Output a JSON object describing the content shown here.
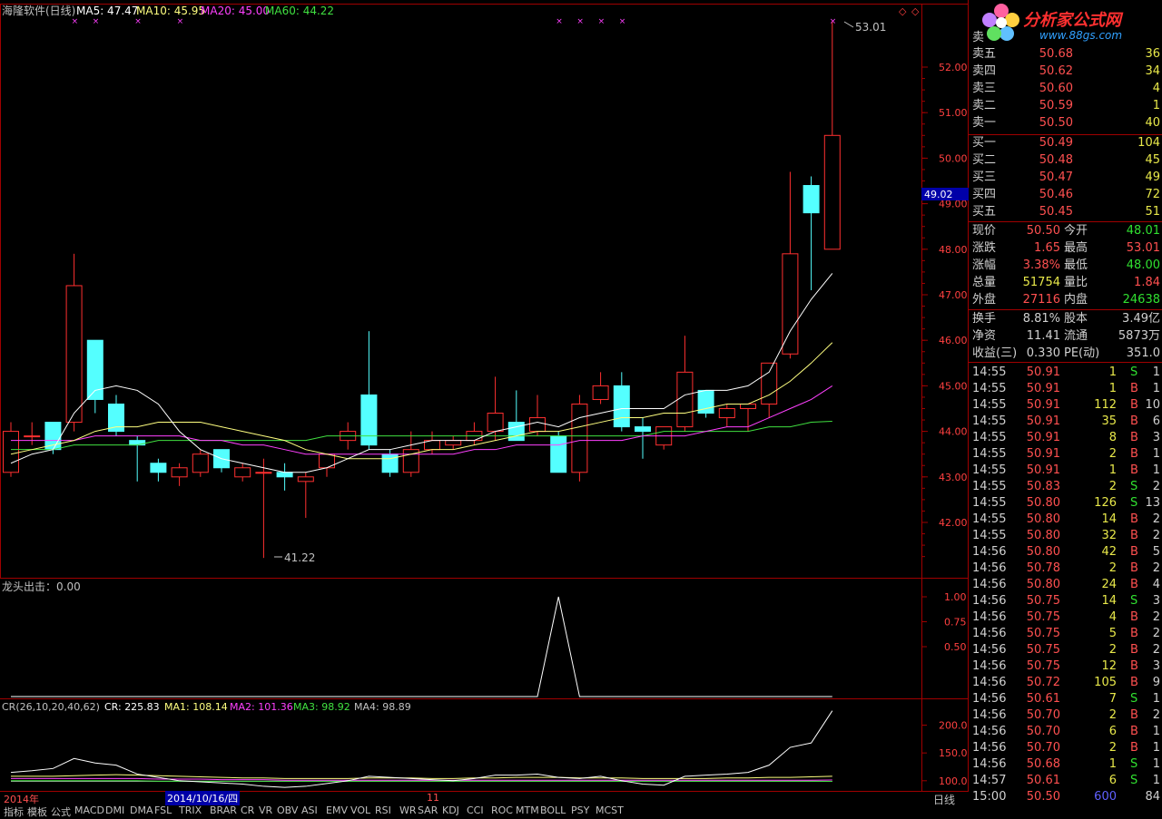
{
  "chart_header": {
    "title": "海隆软件(日线)",
    "ma5": "MA5: 47.47",
    "ma10": "MA10: 45.95",
    "ma20": "MA20: 45.00",
    "ma60": "MA60: 44.22"
  },
  "price_axis": [
    "52.00",
    "51.00",
    "50.00",
    "49.00",
    "48.00",
    "47.00",
    "46.00",
    "45.00",
    "44.00",
    "43.00",
    "42.00"
  ],
  "current_price_tag": "49.02",
  "high_label": "53.01",
  "low_label": "41.22",
  "indicator1": {
    "title": "龙头出击：0.00",
    "axis": [
      "1.00",
      "0.75",
      "0.50"
    ]
  },
  "indicator2": {
    "title": "CR(26,10,20,40,62)",
    "cr": "CR: 225.83",
    "ma1": "MA1: 108.14",
    "ma2": "MA2: 101.36",
    "ma3": "MA3: 98.92",
    "ma4": "MA4: 98.89",
    "axis": [
      "200.0",
      "150.0",
      "100.0"
    ]
  },
  "bottom": {
    "year_label": "2014年",
    "date_cursor": "2014/10/16/四",
    "month_label": "11",
    "period": "日线",
    "tabs": [
      "指标",
      "模板",
      "公式",
      "MACD",
      "DMI",
      "DMA",
      "FSL",
      "TRIX",
      "BRAR",
      "CR",
      "VR",
      "OBV",
      "ASI",
      "EMV",
      "VOL",
      "RSI",
      "WR",
      "SAR",
      "KDJ",
      "CCI",
      "ROC",
      "MTM",
      "BOLL",
      "PSY",
      "MCST"
    ]
  },
  "order_book": {
    "sell_header": "卖",
    "sells": [
      {
        "label": "卖五",
        "price": "50.68",
        "vol": "36"
      },
      {
        "label": "卖四",
        "price": "50.62",
        "vol": "34"
      },
      {
        "label": "卖三",
        "price": "50.60",
        "vol": "4"
      },
      {
        "label": "卖二",
        "price": "50.59",
        "vol": "1"
      },
      {
        "label": "卖一",
        "price": "50.50",
        "vol": "40"
      }
    ],
    "buys": [
      {
        "label": "买一",
        "price": "50.49",
        "vol": "104"
      },
      {
        "label": "买二",
        "price": "50.48",
        "vol": "45"
      },
      {
        "label": "买三",
        "price": "50.47",
        "vol": "49"
      },
      {
        "label": "买四",
        "price": "50.46",
        "vol": "72"
      },
      {
        "label": "买五",
        "price": "50.45",
        "vol": "51"
      }
    ]
  },
  "quote": [
    {
      "l1": "现价",
      "v1": "50.50",
      "l2": "今开",
      "v2": "48.01",
      "c1": "red",
      "c2": "green"
    },
    {
      "l1": "涨跌",
      "v1": "1.65",
      "l2": "最高",
      "v2": "53.01",
      "c1": "red",
      "c2": "red"
    },
    {
      "l1": "涨幅",
      "v1": "3.38%",
      "l2": "最低",
      "v2": "48.00",
      "c1": "red",
      "c2": "green"
    },
    {
      "l1": "总量",
      "v1": "51754",
      "l2": "量比",
      "v2": "1.84",
      "c1": "yellow",
      "c2": "red"
    },
    {
      "l1": "外盘",
      "v1": "27116",
      "l2": "内盘",
      "v2": "24638",
      "c1": "red",
      "c2": "green"
    }
  ],
  "fundamentals": [
    {
      "l1": "换手",
      "v1": "8.81%",
      "l2": "股本",
      "v2": "3.49亿"
    },
    {
      "l1": "净资",
      "v1": "11.41",
      "l2": "流通",
      "v2": "5873万"
    },
    {
      "l1": "收益(三)",
      "v1": "0.330",
      "l2": "PE(动)",
      "v2": "351.0"
    }
  ],
  "ticks": [
    {
      "t": "14:55",
      "p": "50.91",
      "v": "1",
      "s": "S",
      "n": "1"
    },
    {
      "t": "14:55",
      "p": "50.91",
      "v": "1",
      "s": "B",
      "n": "1"
    },
    {
      "t": "14:55",
      "p": "50.91",
      "v": "112",
      "s": "B",
      "n": "10"
    },
    {
      "t": "14:55",
      "p": "50.91",
      "v": "35",
      "s": "B",
      "n": "6"
    },
    {
      "t": "14:55",
      "p": "50.91",
      "v": "8",
      "s": "B",
      "n": "3"
    },
    {
      "t": "14:55",
      "p": "50.91",
      "v": "2",
      "s": "B",
      "n": "1"
    },
    {
      "t": "14:55",
      "p": "50.91",
      "v": "1",
      "s": "B",
      "n": "1"
    },
    {
      "t": "14:55",
      "p": "50.83",
      "v": "2",
      "s": "S",
      "n": "2"
    },
    {
      "t": "14:55",
      "p": "50.80",
      "v": "126",
      "s": "S",
      "n": "13"
    },
    {
      "t": "14:55",
      "p": "50.80",
      "v": "14",
      "s": "B",
      "n": "2"
    },
    {
      "t": "14:55",
      "p": "50.80",
      "v": "32",
      "s": "B",
      "n": "2"
    },
    {
      "t": "14:56",
      "p": "50.80",
      "v": "42",
      "s": "B",
      "n": "5"
    },
    {
      "t": "14:56",
      "p": "50.78",
      "v": "2",
      "s": "B",
      "n": "2"
    },
    {
      "t": "14:56",
      "p": "50.80",
      "v": "24",
      "s": "B",
      "n": "4"
    },
    {
      "t": "14:56",
      "p": "50.75",
      "v": "14",
      "s": "S",
      "n": "3"
    },
    {
      "t": "14:56",
      "p": "50.75",
      "v": "4",
      "s": "B",
      "n": "2"
    },
    {
      "t": "14:56",
      "p": "50.75",
      "v": "5",
      "s": "B",
      "n": "2"
    },
    {
      "t": "14:56",
      "p": "50.75",
      "v": "2",
      "s": "B",
      "n": "2"
    },
    {
      "t": "14:56",
      "p": "50.75",
      "v": "12",
      "s": "B",
      "n": "3"
    },
    {
      "t": "14:56",
      "p": "50.72",
      "v": "105",
      "s": "B",
      "n": "9"
    },
    {
      "t": "14:56",
      "p": "50.61",
      "v": "7",
      "s": "S",
      "n": "1"
    },
    {
      "t": "14:56",
      "p": "50.70",
      "v": "2",
      "s": "B",
      "n": "2"
    },
    {
      "t": "14:56",
      "p": "50.70",
      "v": "6",
      "s": "B",
      "n": "1"
    },
    {
      "t": "14:56",
      "p": "50.70",
      "v": "2",
      "s": "B",
      "n": "1"
    },
    {
      "t": "14:56",
      "p": "50.68",
      "v": "1",
      "s": "S",
      "n": "1"
    },
    {
      "t": "14:57",
      "p": "50.61",
      "v": "6",
      "s": "S",
      "n": "1"
    },
    {
      "t": "15:00",
      "p": "50.50",
      "v": "600",
      "s": "",
      "n": "84"
    }
  ],
  "logo": {
    "text": "分析家公式网",
    "url": "www.88gs.com"
  },
  "colors": {
    "up": "#ff3030",
    "down": "#54ffff",
    "ma5": "#ffffff",
    "ma10": "#ffff80",
    "ma20": "#ff40ff",
    "ma60": "#40e040",
    "grid": "#a00000"
  },
  "chart_data": {
    "type": "candlestick",
    "ylim": [
      41.0,
      53.5
    ],
    "candles": [
      {
        "o": 43.1,
        "h": 44.2,
        "l": 43.0,
        "c": 44.0
      },
      {
        "o": 43.9,
        "h": 44.2,
        "l": 43.7,
        "c": 43.9
      },
      {
        "o": 44.2,
        "h": 44.2,
        "l": 43.5,
        "c": 43.6
      },
      {
        "o": 44.2,
        "h": 47.9,
        "l": 44.0,
        "c": 47.2
      },
      {
        "o": 46.0,
        "h": 46.0,
        "l": 44.4,
        "c": 44.7
      },
      {
        "o": 44.6,
        "h": 44.8,
        "l": 43.9,
        "c": 44.0
      },
      {
        "o": 43.8,
        "h": 43.9,
        "l": 42.9,
        "c": 43.7
      },
      {
        "o": 43.3,
        "h": 43.4,
        "l": 42.9,
        "c": 43.1
      },
      {
        "o": 43.0,
        "h": 43.3,
        "l": 42.8,
        "c": 43.2
      },
      {
        "o": 43.1,
        "h": 43.6,
        "l": 43.0,
        "c": 43.5
      },
      {
        "o": 43.6,
        "h": 43.6,
        "l": 43.1,
        "c": 43.2
      },
      {
        "o": 43.0,
        "h": 43.3,
        "l": 42.9,
        "c": 43.2
      },
      {
        "o": 43.1,
        "h": 43.4,
        "l": 41.22,
        "c": 43.1
      },
      {
        "o": 43.1,
        "h": 43.3,
        "l": 42.7,
        "c": 43.0
      },
      {
        "o": 42.9,
        "h": 43.1,
        "l": 42.1,
        "c": 43.0
      },
      {
        "o": 43.2,
        "h": 43.5,
        "l": 43.0,
        "c": 43.5
      },
      {
        "o": 43.8,
        "h": 44.2,
        "l": 43.6,
        "c": 44.0
      },
      {
        "o": 44.8,
        "h": 46.2,
        "l": 43.6,
        "c": 43.7
      },
      {
        "o": 43.5,
        "h": 43.6,
        "l": 43.0,
        "c": 43.1
      },
      {
        "o": 43.1,
        "h": 44.0,
        "l": 43.0,
        "c": 43.6
      },
      {
        "o": 43.6,
        "h": 44.0,
        "l": 43.5,
        "c": 43.8
      },
      {
        "o": 43.7,
        "h": 43.9,
        "l": 43.6,
        "c": 43.8
      },
      {
        "o": 43.8,
        "h": 44.2,
        "l": 43.7,
        "c": 44.0
      },
      {
        "o": 44.0,
        "h": 45.2,
        "l": 43.8,
        "c": 44.4
      },
      {
        "o": 44.2,
        "h": 44.9,
        "l": 43.8,
        "c": 43.8
      },
      {
        "o": 44.0,
        "h": 44.8,
        "l": 43.9,
        "c": 44.3
      },
      {
        "o": 43.9,
        "h": 44.0,
        "l": 43.1,
        "c": 43.1
      },
      {
        "o": 43.1,
        "h": 44.8,
        "l": 42.9,
        "c": 44.6
      },
      {
        "o": 44.7,
        "h": 45.3,
        "l": 44.6,
        "c": 45.0
      },
      {
        "o": 45.0,
        "h": 45.3,
        "l": 44.0,
        "c": 44.1
      },
      {
        "o": 44.1,
        "h": 44.3,
        "l": 43.4,
        "c": 44.0
      },
      {
        "o": 43.7,
        "h": 44.1,
        "l": 43.6,
        "c": 44.1
      },
      {
        "o": 44.1,
        "h": 46.1,
        "l": 44.0,
        "c": 45.3
      },
      {
        "o": 44.9,
        "h": 44.9,
        "l": 44.3,
        "c": 44.4
      },
      {
        "o": 44.3,
        "h": 44.6,
        "l": 44.1,
        "c": 44.5
      },
      {
        "o": 44.5,
        "h": 44.6,
        "l": 44.0,
        "c": 44.6
      },
      {
        "o": 44.6,
        "h": 45.5,
        "l": 44.3,
        "c": 45.5
      },
      {
        "o": 45.7,
        "h": 49.7,
        "l": 45.6,
        "c": 47.9
      },
      {
        "o": 49.4,
        "h": 49.6,
        "l": 47.1,
        "c": 48.8
      },
      {
        "o": 48.0,
        "h": 53.01,
        "l": 48.0,
        "c": 50.5
      }
    ],
    "ma5": [
      43.3,
      43.5,
      43.6,
      44.4,
      44.9,
      45.0,
      44.9,
      44.6,
      44.0,
      43.6,
      43.4,
      43.3,
      43.2,
      43.1,
      43.1,
      43.2,
      43.4,
      43.6,
      43.6,
      43.7,
      43.8,
      43.8,
      43.8,
      44.0,
      44.1,
      44.2,
      44.1,
      44.3,
      44.4,
      44.5,
      44.5,
      44.5,
      44.8,
      44.9,
      44.9,
      45.0,
      45.3,
      46.2,
      46.9,
      47.47
    ],
    "ma10": [
      43.5,
      43.6,
      43.7,
      43.8,
      44.0,
      44.1,
      44.1,
      44.2,
      44.2,
      44.2,
      44.1,
      44.0,
      43.9,
      43.8,
      43.6,
      43.5,
      43.4,
      43.4,
      43.4,
      43.5,
      43.6,
      43.6,
      43.7,
      43.8,
      43.9,
      44.0,
      44.0,
      44.1,
      44.2,
      44.3,
      44.3,
      44.4,
      44.4,
      44.5,
      44.6,
      44.6,
      44.8,
      45.1,
      45.5,
      45.95
    ],
    "ma20": [
      43.8,
      43.8,
      43.8,
      43.8,
      43.9,
      43.9,
      43.9,
      43.9,
      43.9,
      43.8,
      43.8,
      43.7,
      43.7,
      43.6,
      43.5,
      43.5,
      43.5,
      43.5,
      43.5,
      43.5,
      43.5,
      43.5,
      43.6,
      43.6,
      43.7,
      43.7,
      43.7,
      43.8,
      43.8,
      43.8,
      43.9,
      43.9,
      43.9,
      44.0,
      44.1,
      44.1,
      44.3,
      44.5,
      44.7,
      45.0
    ],
    "ma60": [
      43.6,
      43.6,
      43.6,
      43.7,
      43.7,
      43.7,
      43.7,
      43.8,
      43.8,
      43.8,
      43.8,
      43.8,
      43.8,
      43.8,
      43.8,
      43.9,
      43.9,
      43.9,
      43.9,
      43.9,
      43.9,
      43.9,
      43.9,
      43.9,
      43.9,
      43.9,
      43.9,
      43.9,
      43.9,
      43.9,
      43.9,
      44.0,
      44.0,
      44.0,
      44.0,
      44.0,
      44.1,
      44.1,
      44.2,
      44.22
    ],
    "signal": [
      0,
      0,
      0,
      0,
      0,
      0,
      0,
      0,
      0,
      0,
      0,
      0,
      0,
      0,
      0,
      0,
      0,
      0,
      0,
      0,
      0,
      0,
      0,
      0,
      0,
      0,
      1,
      0,
      0,
      0,
      0,
      0,
      0,
      0,
      0,
      0,
      0,
      0,
      0,
      0
    ],
    "cr_values": [
      115,
      118,
      122,
      140,
      132,
      128,
      112,
      106,
      100,
      98,
      96,
      94,
      90,
      88,
      90,
      95,
      100,
      108,
      106,
      104,
      102,
      100,
      104,
      110,
      110,
      112,
      106,
      104,
      108,
      100,
      94,
      92,
      108,
      110,
      112,
      115,
      128,
      160,
      168,
      225.83
    ],
    "cr_ma1": [
      108,
      108,
      108,
      109,
      110,
      111,
      110,
      109,
      108,
      107,
      106,
      105,
      105,
      104,
      104,
      104,
      104,
      105,
      105,
      105,
      104,
      104,
      105,
      105,
      106,
      106,
      106,
      105,
      105,
      105,
      104,
      104,
      104,
      104,
      105,
      105,
      106,
      106,
      107,
      108.14
    ],
    "cr_ma2": [
      104,
      104,
      104,
      104,
      104,
      104,
      104,
      103,
      103,
      103,
      102,
      102,
      102,
      101,
      101,
      101,
      101,
      101,
      101,
      101,
      101,
      101,
      101,
      101,
      101,
      101,
      101,
      101,
      101,
      101,
      101,
      101,
      101,
      101,
      101,
      101,
      101,
      101,
      101,
      101.36
    ],
    "cr_ma3": [
      100,
      100,
      100,
      100,
      100,
      100,
      100,
      99,
      99,
      99,
      99,
      99,
      99,
      99,
      99,
      99,
      99,
      99,
      99,
      99,
      99,
      99,
      99,
      99,
      99,
      99,
      99,
      99,
      99,
      99,
      99,
      99,
      99,
      99,
      99,
      99,
      99,
      99,
      99,
      98.92
    ],
    "cr_ma4": [
      99,
      99,
      99,
      99,
      99,
      99,
      99,
      99,
      99,
      99,
      99,
      99,
      99,
      99,
      99,
      99,
      99,
      99,
      99,
      99,
      99,
      99,
      99,
      99,
      99,
      99,
      99,
      99,
      99,
      99,
      99,
      99,
      99,
      99,
      99,
      99,
      99,
      99,
      99,
      98.89
    ],
    "cr_ylim": [
      85,
      240
    ]
  }
}
